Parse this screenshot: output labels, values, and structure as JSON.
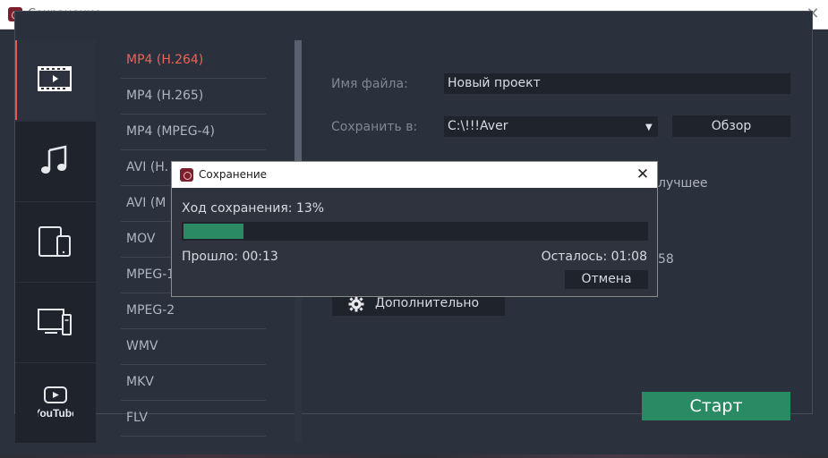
{
  "window": {
    "title": "Сохранение",
    "close_glyph": "✕"
  },
  "categories": [
    {
      "name": "video",
      "icon": "film-icon",
      "active": true
    },
    {
      "name": "audio",
      "icon": "music-note-icon",
      "active": false
    },
    {
      "name": "devices",
      "icon": "tablet-phone-icon",
      "active": false
    },
    {
      "name": "tv",
      "icon": "tv-icon",
      "active": false
    },
    {
      "name": "youtube",
      "icon": "youtube-icon",
      "label": "YouTube",
      "active": false
    }
  ],
  "formats": [
    {
      "label": "MP4 (H.264)",
      "active": true
    },
    {
      "label": "MP4 (H.265)",
      "active": false
    },
    {
      "label": "MP4 (MPEG-4)",
      "active": false
    },
    {
      "label": "AVI (H.",
      "active": false
    },
    {
      "label": "AVI (M",
      "active": false
    },
    {
      "label": "MOV",
      "active": false
    },
    {
      "label": "MPEG-1",
      "active": false
    },
    {
      "label": "MPEG-2",
      "active": false
    },
    {
      "label": "WMV",
      "active": false
    },
    {
      "label": "MKV",
      "active": false
    },
    {
      "label": "FLV",
      "active": false
    }
  ],
  "settings": {
    "filename_label": "Имя файла:",
    "filename_value": "Новый проект",
    "save_to_label": "Сохранить в:",
    "save_to_value": "C:\\!!!Aver",
    "dropdown_glyph": "▼",
    "browse_label": "Обзор",
    "partial_quality_text": "лучшее",
    "partial_number_text": "58",
    "advanced_label": "Дополнительно",
    "start_label": "Старт"
  },
  "dialog": {
    "title": "Сохранение",
    "close_glyph": "✕",
    "progress_text": "Ход сохранения: 13%",
    "progress_fraction": 0.13,
    "elapsed_text": "Прошло: 00:13",
    "remaining_text": "Осталось: 01:08",
    "cancel_label": "Отмена"
  },
  "colors": {
    "accent_red": "#e86559",
    "accent_green": "#2a8a64",
    "panel_dark": "#1f242c",
    "background": "#2c323d"
  }
}
